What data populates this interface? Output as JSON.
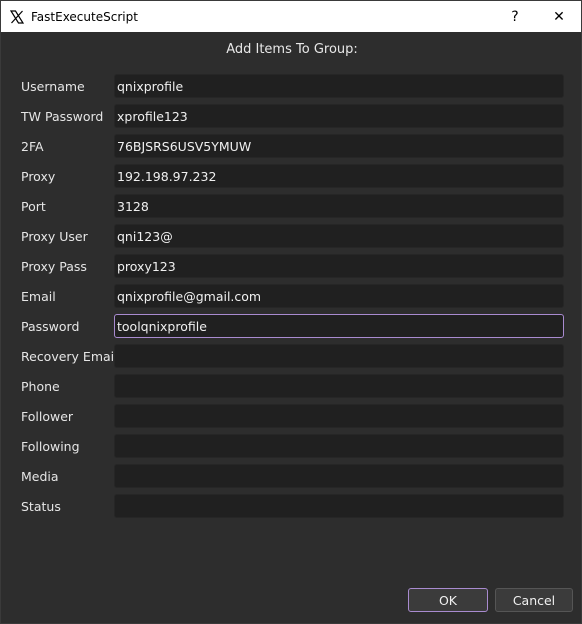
{
  "window": {
    "title": "FastExecuteScript",
    "help_glyph": "?",
    "close_glyph": "✕",
    "icon": "x-logo-icon"
  },
  "dialog": {
    "heading": "Add Items To Group:"
  },
  "fields": [
    {
      "label": "Username",
      "value": "qnixprofile"
    },
    {
      "label": "TW Password",
      "value": "xprofile123"
    },
    {
      "label": "2FA",
      "value": "76BJSRS6USV5YMUW"
    },
    {
      "label": "Proxy",
      "value": "192.198.97.232"
    },
    {
      "label": "Port",
      "value": "3128"
    },
    {
      "label": "Proxy User",
      "value": "qni123@"
    },
    {
      "label": "Proxy Pass",
      "value": "proxy123"
    },
    {
      "label": "Email",
      "value": "qnixprofile@gmail.com"
    },
    {
      "label": "Password",
      "value": "toolqnixprofile",
      "focused": true
    },
    {
      "label": "Recovery Email",
      "value": ""
    },
    {
      "label": "Phone",
      "value": ""
    },
    {
      "label": "Follower",
      "value": ""
    },
    {
      "label": "Following",
      "value": ""
    },
    {
      "label": "Media",
      "value": ""
    },
    {
      "label": "Status",
      "value": ""
    }
  ],
  "buttons": {
    "ok_label": "OK",
    "cancel_label": "Cancel"
  },
  "colors": {
    "background": "#2d2d2d",
    "input_bg": "#202020",
    "focus_accent": "#a98bd0"
  }
}
